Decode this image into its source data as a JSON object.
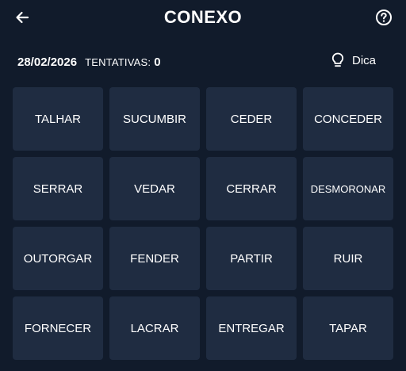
{
  "header": {
    "title": "CONEXO",
    "back_icon": "arrow-left-icon",
    "help_icon": "question-circle-icon"
  },
  "info": {
    "date": "28/02/2026",
    "attempts_label": "TENTATIVAS:",
    "attempts_count": "0",
    "hint_label": "Dica",
    "hint_icon": "lightbulb-icon"
  },
  "tiles": [
    {
      "label": "TALHAR"
    },
    {
      "label": "SUCUMBIR"
    },
    {
      "label": "CEDER"
    },
    {
      "label": "CONCEDER"
    },
    {
      "label": "SERRAR"
    },
    {
      "label": "VEDAR"
    },
    {
      "label": "CERRAR"
    },
    {
      "label": "DESMORONAR"
    },
    {
      "label": "OUTORGAR"
    },
    {
      "label": "FENDER"
    },
    {
      "label": "PARTIR"
    },
    {
      "label": "RUIR"
    },
    {
      "label": "FORNECER"
    },
    {
      "label": "LACRAR"
    },
    {
      "label": "ENTREGAR"
    },
    {
      "label": "TAPAR"
    }
  ],
  "colors": {
    "background": "#111b2b",
    "tile": "#1f2c41",
    "text": "#ffffff"
  }
}
